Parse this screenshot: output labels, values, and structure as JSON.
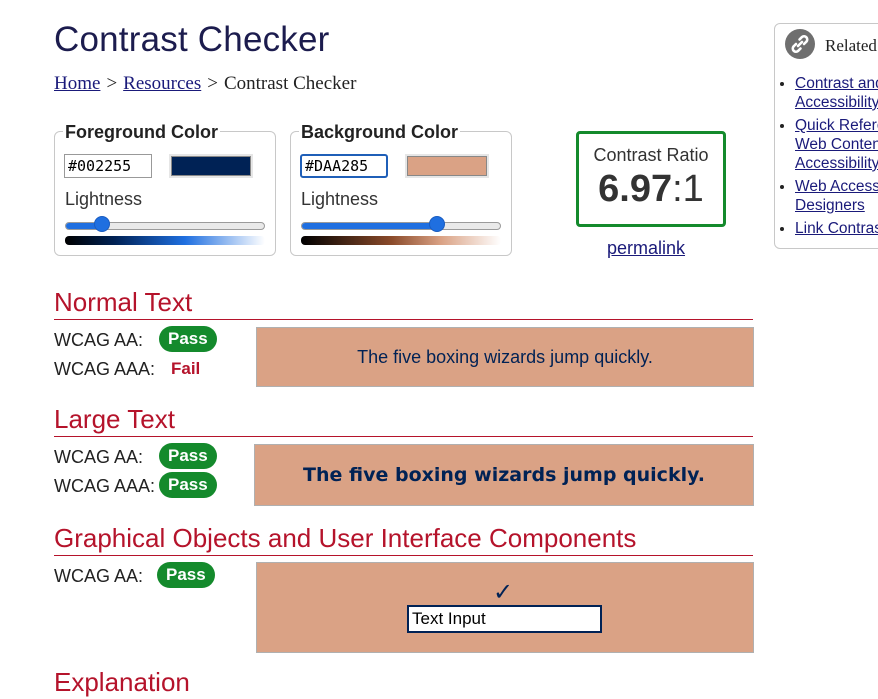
{
  "page": {
    "title": "Contrast Checker"
  },
  "breadcrumb": {
    "home": "Home",
    "sep1": ">",
    "resources": "Resources",
    "sep2": ">",
    "current": "Contrast Checker"
  },
  "foreground": {
    "legend": "Foreground Color",
    "hex": "#002255",
    "swatch_color": "#002255",
    "lightness_label": "Lightness",
    "lightness_fraction": 0.18
  },
  "background": {
    "legend": "Background Color",
    "hex": "#DAA285",
    "swatch_color": "#DAA285",
    "lightness_label": "Lightness",
    "lightness_fraction": 0.68
  },
  "ratio": {
    "label": "Contrast Ratio",
    "value": "6.97",
    "suffix": ":1",
    "border_color": "#148a2c"
  },
  "permalink": "permalink",
  "related": {
    "title": "Related",
    "links": [
      "Contrast and\nAccessibility",
      "Quick Refere\nWeb Conten\nAccessibility",
      "Web Access\nDesigners",
      "Link Contras"
    ]
  },
  "sections": {
    "normal": {
      "heading": "Normal Text",
      "aa_label": "WCAG AA:",
      "aa_result": "Pass",
      "aaa_label": "WCAG AAA:",
      "aaa_result": "Fail",
      "sample": "The five boxing wizards jump quickly."
    },
    "large": {
      "heading": "Large Text",
      "aa_label": "WCAG AA:",
      "aa_result": "Pass",
      "aaa_label": "WCAG AAA:",
      "aaa_result": "Pass",
      "sample": "The five boxing wizards jump quickly."
    },
    "graphical": {
      "heading": "Graphical Objects and User Interface Components",
      "aa_label": "WCAG AA:",
      "aa_result": "Pass",
      "check_glyph": "✓",
      "input_value": "Text Input"
    },
    "explanation": {
      "heading": "Explanation"
    }
  },
  "colors": {
    "pass": "#148a2c",
    "fail": "#b5132b",
    "heading": "#b5132b",
    "link": "#1a1a7a"
  }
}
